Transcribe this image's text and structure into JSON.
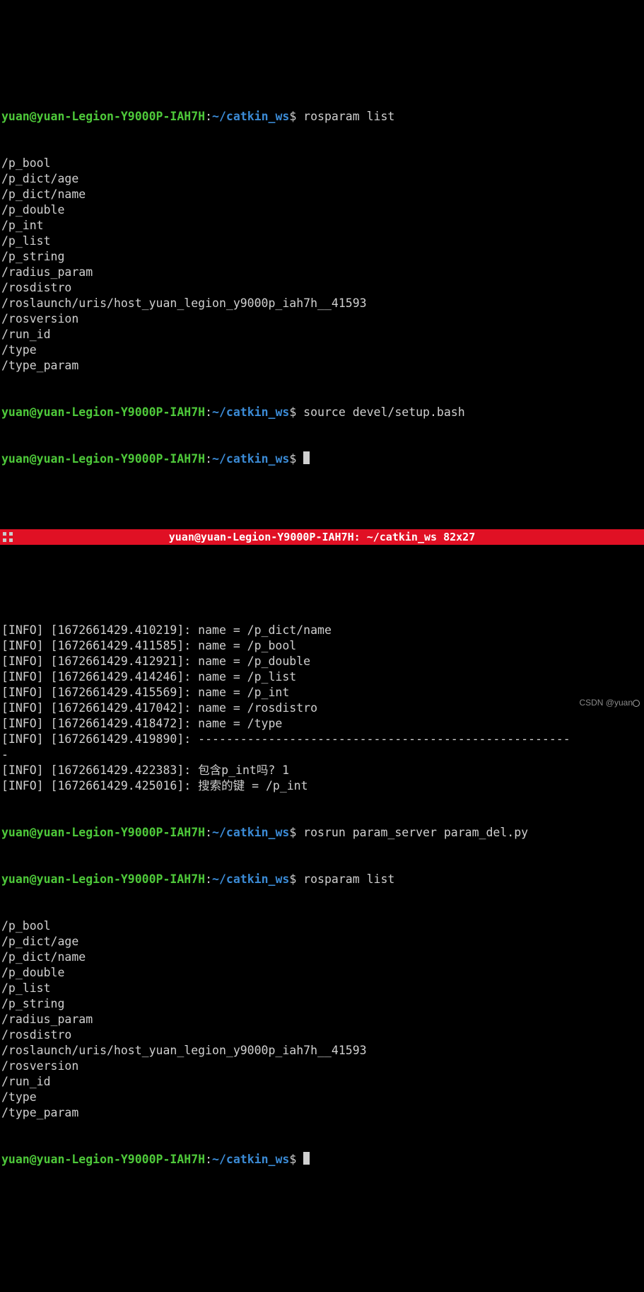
{
  "colors": {
    "user": "#4ec93a",
    "path": "#3b8bd6",
    "titlebar_bg": "#e01024"
  },
  "prompt": {
    "user_host": "yuan@yuan-Legion-Y9000P-IAH7H",
    "sep": ":",
    "tilde": "~",
    "cwd": "/catkin_ws",
    "marker": "$"
  },
  "top_pane": {
    "cmd1": " rosparam list",
    "cmd2": " source devel/setup.bash",
    "params": [
      "/p_bool",
      "/p_dict/age",
      "/p_dict/name",
      "/p_double",
      "/p_int",
      "/p_list",
      "/p_string",
      "/radius_param",
      "/rosdistro",
      "/roslaunch/uris/host_yuan_legion_y9000p_iah7h__41593",
      "/rosversion",
      "/run_id",
      "/type",
      "/type_param"
    ]
  },
  "titlebar": {
    "text": "yuan@yuan-Legion-Y9000P-IAH7H: ~/catkin_ws 82x27"
  },
  "bottom_pane": {
    "info_lines": [
      "[INFO] [1672661429.410219]: name = /p_dict/name",
      "[INFO] [1672661429.411585]: name = /p_bool",
      "[INFO] [1672661429.412921]: name = /p_double",
      "[INFO] [1672661429.414246]: name = /p_list",
      "[INFO] [1672661429.415569]: name = /p_int",
      "[INFO] [1672661429.417042]: name = /rosdistro",
      "[INFO] [1672661429.418472]: name = /type",
      "[INFO] [1672661429.419890]: -----------------------------------------------------",
      "-",
      "[INFO] [1672661429.422383]: 包含p_int吗? 1",
      "[INFO] [1672661429.425016]: 搜索的键 = /p_int"
    ],
    "cmd1": " rosrun param_server param_del.py",
    "cmd2": " rosparam list",
    "params": [
      "/p_bool",
      "/p_dict/age",
      "/p_dict/name",
      "/p_double",
      "/p_list",
      "/p_string",
      "/radius_param",
      "/rosdistro",
      "/roslaunch/uris/host_yuan_legion_y9000p_iah7h__41593",
      "/rosversion",
      "/run_id",
      "/type",
      "/type_param"
    ]
  },
  "watermark": "CSDN @yuan"
}
